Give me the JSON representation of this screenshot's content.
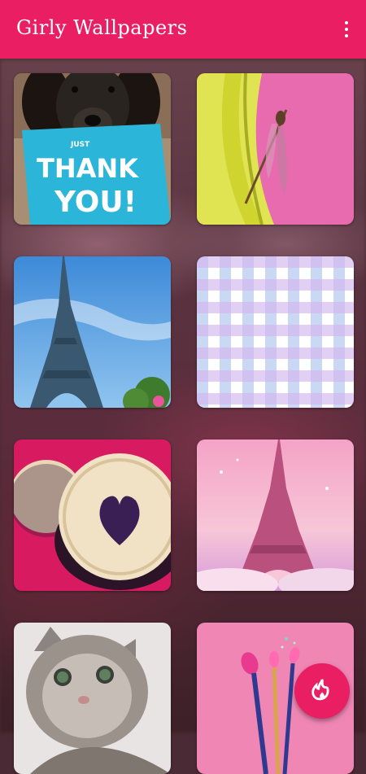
{
  "app": {
    "title": "Girly Wallpapers"
  },
  "colors": {
    "primary": "#e91e63"
  },
  "icons": {
    "menu": "more-vert-icon",
    "fab": "flame-icon"
  },
  "wallpapers": [
    {
      "subject": "dog-thank-you-sign",
      "card_text": [
        "JUST",
        "THANK",
        "YOU!"
      ]
    },
    {
      "subject": "dragonfly-on-banana"
    },
    {
      "subject": "eiffel-tower-blue-sky"
    },
    {
      "subject": "pastel-gingham-pattern"
    },
    {
      "subject": "heart-cookie"
    },
    {
      "subject": "pink-eiffel-tower"
    },
    {
      "subject": "tabby-kitten"
    },
    {
      "subject": "makeup-brushes-pink"
    }
  ]
}
